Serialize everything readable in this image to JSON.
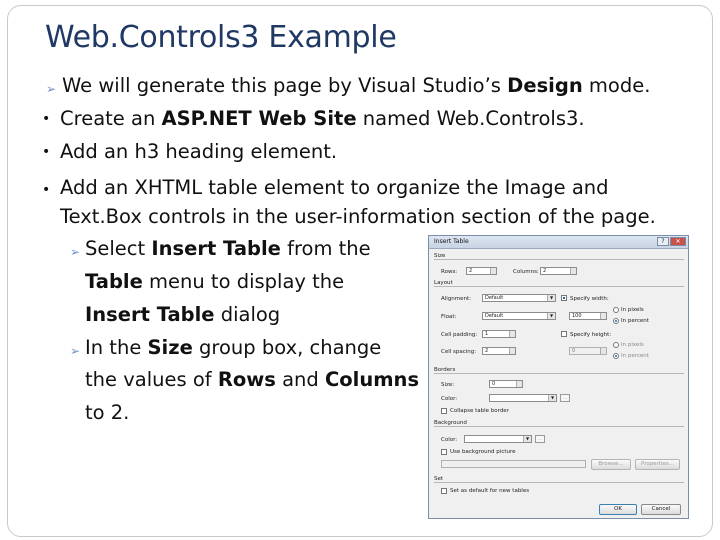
{
  "slide": {
    "title": "Web.Controls3 Example",
    "title_display": "Web.Controls3 Example",
    "lines": [
      {
        "pre": "We will generate this page by Visual Studio’s ",
        "bold": "Design",
        "post": " mode."
      },
      {
        "pre": "Create an ",
        "bold": "ASP.NET Web Site",
        "post": " named Web.Controls3."
      },
      {
        "pre": "Add an h3 heading element.",
        "bold": "",
        "post": ""
      },
      {
        "pre": "Add an XHTML table element to organize the Image and",
        "bold": "",
        "post": ""
      },
      {
        "pre": "Text.Box controls in the user-information section of the page.",
        "bold": "",
        "post": ""
      },
      {
        "pre": "Select ",
        "bold": "Insert Table",
        "post": " from the"
      },
      {
        "pre": "",
        "bold": "Table",
        "post": " menu to display the"
      },
      {
        "pre": "",
        "bold": "Insert Table",
        "post": " dialog"
      },
      {
        "pre": "In the ",
        "bold": "Size",
        "post": " group box, change"
      },
      {
        "pre": "the values of ",
        "bold": "Rows",
        "post": " and "
      },
      {
        "pre": "to 2.",
        "bold": "",
        "post": ""
      }
    ],
    "line10_bold2": "Columns"
  },
  "dialog": {
    "title": "Insert Table",
    "help": "?",
    "close": "✕",
    "size": {
      "group": "Size",
      "rows_label": "Rows:",
      "rows_value": "2",
      "columns_label": "Columns:",
      "columns_value": "2"
    },
    "layout": {
      "group": "Layout",
      "alignment_label": "Alignment:",
      "alignment_value": "Default",
      "float_label": "Float:",
      "float_value": "Default",
      "cellpadding_label": "Cell padding:",
      "cellpadding_value": "1",
      "cellspacing_label": "Cell spacing:",
      "cellspacing_value": "2",
      "specify_width_label": "Specify width:",
      "width_value": "100",
      "in_pixels": "In pixels",
      "in_percent": "In percent",
      "specify_height_label": "Specify height:",
      "height_value": "0",
      "in_pixels2": "In pixels",
      "in_percent2": "In percent"
    },
    "borders": {
      "group": "Borders",
      "size_label": "Size:",
      "size_value": "0",
      "color_label": "Color:",
      "collapse_label": "Collapse table border"
    },
    "background": {
      "group": "Background",
      "color_label": "Color:",
      "use_picture_label": "Use background picture",
      "browse_button": "Browse...",
      "properties_button": "Properties..."
    },
    "set": {
      "group": "Set",
      "default_label": "Set as default for new tables"
    },
    "ok_button": "OK",
    "cancel_button": "Cancel"
  },
  "colors": {
    "title": "#1f3864",
    "arrow_bullet": "#6b8fc7",
    "frame": "#c9c9c9"
  }
}
